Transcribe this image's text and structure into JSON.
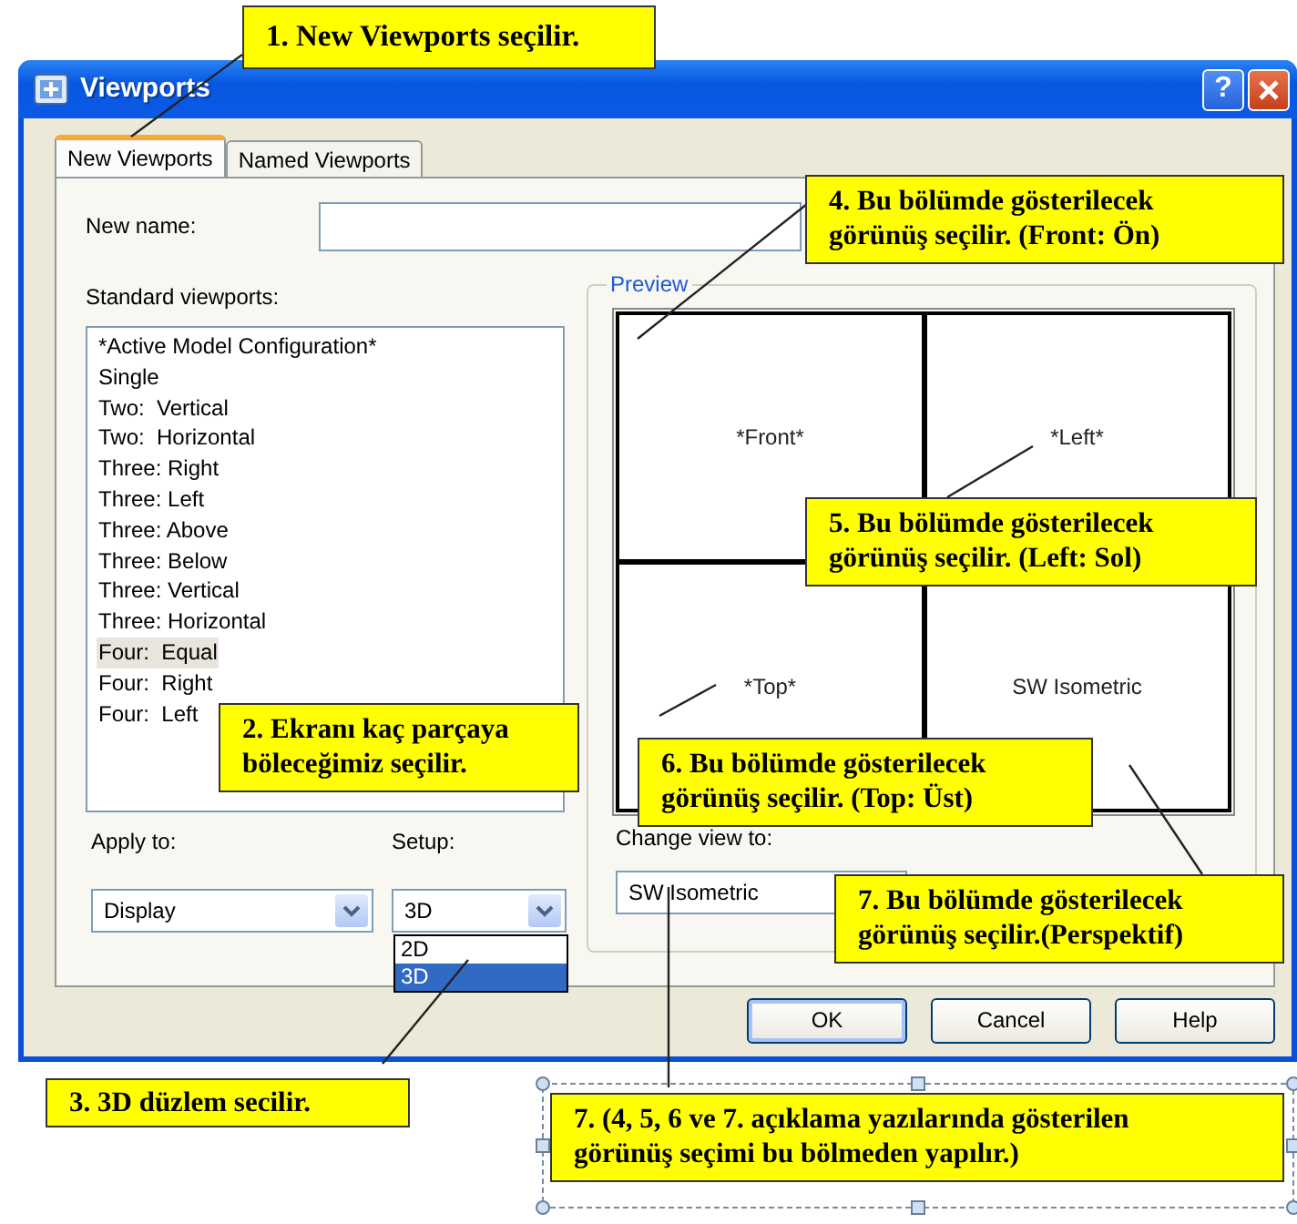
{
  "window": {
    "title": "Viewports",
    "help_button": "?"
  },
  "tabs": [
    {
      "label": "New Viewports",
      "selected": true
    },
    {
      "label": "Named Viewports",
      "selected": false
    }
  ],
  "new_name": {
    "label": "New name:"
  },
  "standard_viewports": {
    "label": "Standard viewports:",
    "items": [
      {
        "label": "*Active Model Configuration*",
        "selected": false
      },
      {
        "label": "Single",
        "selected": false
      },
      {
        "label": "Two:  Vertical",
        "selected": false
      },
      {
        "label": "Two:  Horizontal",
        "selected": false
      },
      {
        "label": "Three: Right",
        "selected": false
      },
      {
        "label": "Three: Left",
        "selected": false
      },
      {
        "label": "Three: Above",
        "selected": false
      },
      {
        "label": "Three: Below",
        "selected": false
      },
      {
        "label": "Three: Vertical",
        "selected": false
      },
      {
        "label": "Three: Horizontal",
        "selected": false
      },
      {
        "label": "Four:  Equal",
        "selected": true
      },
      {
        "label": "Four:  Right",
        "selected": false
      },
      {
        "label": "Four:  Left",
        "selected": false
      }
    ]
  },
  "preview": {
    "label": "Preview",
    "panes": [
      {
        "label": "*Front*"
      },
      {
        "label": "*Left*"
      },
      {
        "label": "*Top*"
      },
      {
        "label": "SW Isometric"
      }
    ]
  },
  "apply_to": {
    "label": "Apply to:",
    "value": "Display"
  },
  "setup": {
    "label": "Setup:",
    "value": "3D",
    "expanded": true,
    "options": [
      {
        "label": "2D",
        "selected": false
      },
      {
        "label": "3D",
        "selected": true
      }
    ]
  },
  "change_view_to": {
    "label": "Change view to:",
    "value": "SW Isometric"
  },
  "buttons": [
    "OK",
    "Cancel",
    "Help"
  ],
  "annotations": [
    {
      "text": "1. New Viewports seçilir."
    },
    {
      "text": "2. Ekranı kaç parçaya böleceğimiz seçilir."
    },
    {
      "text": "3. 3D düzlem secilir."
    },
    {
      "text": "4. Bu bölümde gösterilecek görünüş seçilir. (Front: Ön)"
    },
    {
      "text": "5. Bu bölümde gösterilecek görünüş seçilir. (Left: Sol)"
    },
    {
      "text": "6. Bu bölümde gösterilecek görünüş seçilir. (Top: Üst)"
    },
    {
      "text": "7. Bu bölümde gösterilecek görünüş seçilir.(Perspektif)"
    },
    {
      "text": "7. (4, 5, 6 ve 7. açıklama yazılarında gösterilen görünüş seçimi bu bölmeden yapılır.)"
    }
  ]
}
